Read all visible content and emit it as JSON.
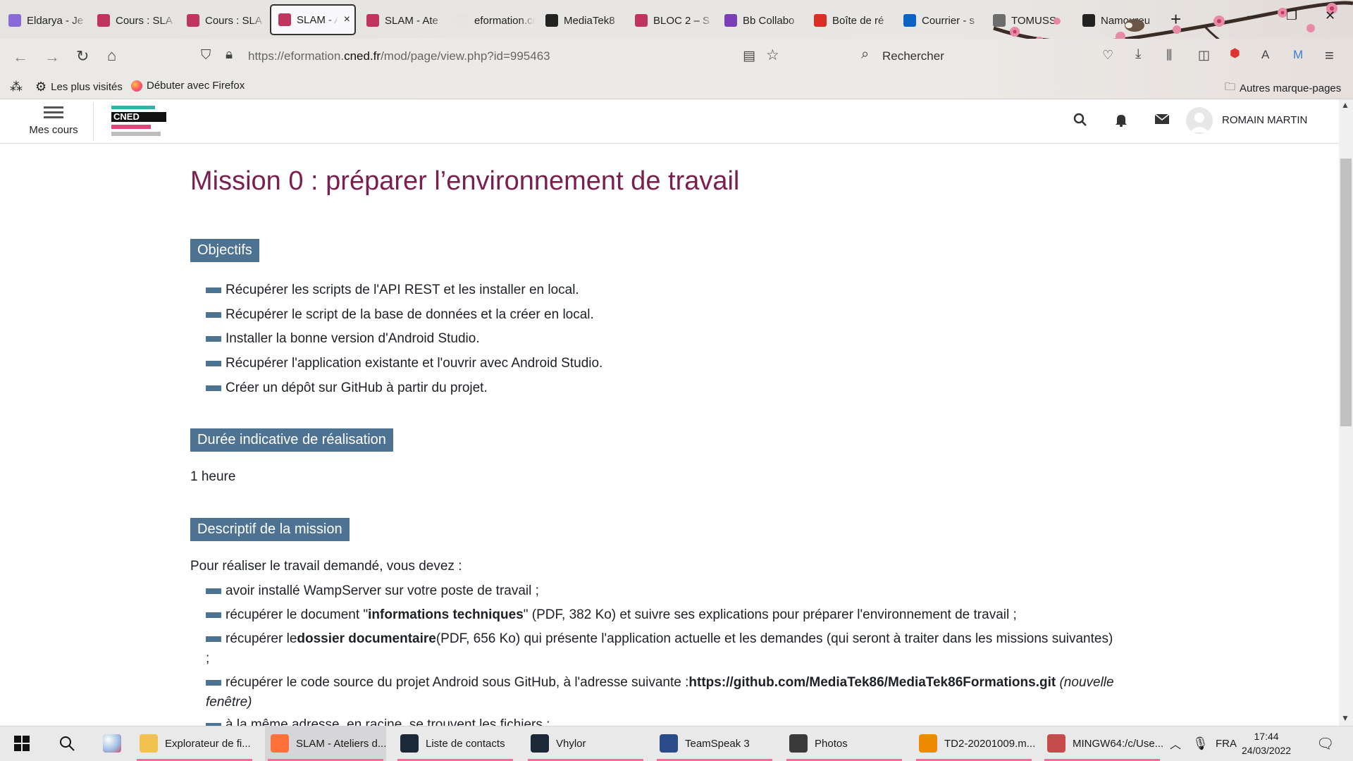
{
  "browser": {
    "tabs": [
      {
        "title": "Eldarya - Je",
        "icon": "eldarya-icon",
        "color": "#8a6ad8"
      },
      {
        "title": "Cours : SLA",
        "icon": "cned-icon",
        "color": "#c0355e"
      },
      {
        "title": "Cours : SLA",
        "icon": "cned-icon",
        "color": "#c0355e"
      },
      {
        "title": "SLAM - A",
        "icon": "cned-icon",
        "color": "#c0355e",
        "active": true,
        "close": "×"
      },
      {
        "title": "SLAM - Ate",
        "icon": "cned-icon",
        "color": "#c0355e"
      },
      {
        "title": "eformation.cne",
        "icon": "blank-icon",
        "color": "#e6e4e1"
      },
      {
        "title": "MediaTek8",
        "icon": "github-icon",
        "color": "#222222"
      },
      {
        "title": "BLOC 2 – S",
        "icon": "cned-icon",
        "color": "#c0355e"
      },
      {
        "title": "Bb Collabo",
        "icon": "collaborate-icon",
        "color": "#7b3fb5"
      },
      {
        "title": "Boîte de ré",
        "icon": "gmail-icon",
        "color": "#d93025"
      },
      {
        "title": "Courrier - s",
        "icon": "outlook-icon",
        "color": "#0a64c8"
      },
      {
        "title": "TOMUSS",
        "icon": "tomuss-icon",
        "color": "#6d6d6d"
      },
      {
        "title": "Namoureu",
        "icon": "github-icon",
        "color": "#222222"
      }
    ],
    "new_tab": "+",
    "url_prefix": "https://eformation.",
    "url_domain": "cned.fr",
    "url_suffix": "/mod/page/view.php?id=995463",
    "search_placeholder": "Rechercher",
    "bookmarks": [
      {
        "label": "Les plus visités",
        "icon": "gear-icon"
      },
      {
        "label": "Débuter avec Firefox",
        "icon": "firefox-icon"
      }
    ],
    "other_bookmarks": "Autres marque-pages"
  },
  "site": {
    "menu_label": "Mes cours",
    "logo_text": "CNED",
    "user_name": "ROMAIN MARTIN"
  },
  "page": {
    "title": "Mission 0 : préparer l’environnement de travail",
    "sections": {
      "objectifs": "Objectifs",
      "duree": "Durée indicative de réalisation",
      "descriptif": "Descriptif de la mission"
    },
    "objectifs": [
      "Récupérer les scripts de l'API REST et les installer en local.",
      "Récupérer le script de la base de données et la créer en local.",
      "Installer la bonne version d'Android Studio.",
      "Récupérer l'application existante et l'ouvrir avec Android Studio.",
      "Créer un dépôt sur GitHub à partir du projet."
    ],
    "duree_value": "1 heure",
    "descriptif_intro": "Pour réaliser le travail demandé, vous devez :",
    "descriptif_items": {
      "item1": "avoir installé WampServer sur votre poste de travail ;",
      "item2_pre": "récupérer le document \"",
      "item2_bold": "informations techniques",
      "item2_post": "\" (PDF, 382 Ko) et suivre ses explications pour préparer l'environnement de travail ;",
      "item3_pre": "récupérer le ",
      "item3_bold": "dossier documentaire",
      "item3_post": " (PDF, 656 Ko) qui présente l'application actuelle et les demandes (qui seront à traiter dans les missions suivantes)",
      "item3_cont": ";",
      "item4_pre": "récupérer le code source du projet Android sous GitHub, à l'adresse suivante : ",
      "item4_bold": "https://github.com/MediaTek86/MediaTek86Formations.git",
      "item4_italic": "(nouvelle",
      "item4_cont": "fenêtre)",
      "item5_partial": "à la même adresse, en racine, se trouvent les fichiers :"
    }
  },
  "taskbar": {
    "apps": [
      {
        "label": "Explorateur de fi...",
        "icon": "folder-icon",
        "color": "#f2c14e"
      },
      {
        "label": "SLAM - Ateliers d...",
        "icon": "firefox-icon",
        "color": "#ff7139",
        "active": true
      },
      {
        "label": "Liste de contacts",
        "icon": "steam-icon",
        "color": "#1b2838"
      },
      {
        "label": "Vhylor",
        "icon": "steam-icon",
        "color": "#1b2838"
      },
      {
        "label": "TeamSpeak 3",
        "icon": "teamspeak-icon",
        "color": "#2a4a8a"
      },
      {
        "label": "Photos",
        "icon": "photos-icon",
        "color": "#3a3a3a"
      },
      {
        "label": "TD2-20201009.m...",
        "icon": "vlc-icon",
        "color": "#f08a00"
      },
      {
        "label": "MINGW64:/c/Use...",
        "icon": "git-icon",
        "color": "#c84b4b"
      }
    ],
    "lang": "FRA",
    "time": "17:44",
    "date": "24/03/2022"
  }
}
